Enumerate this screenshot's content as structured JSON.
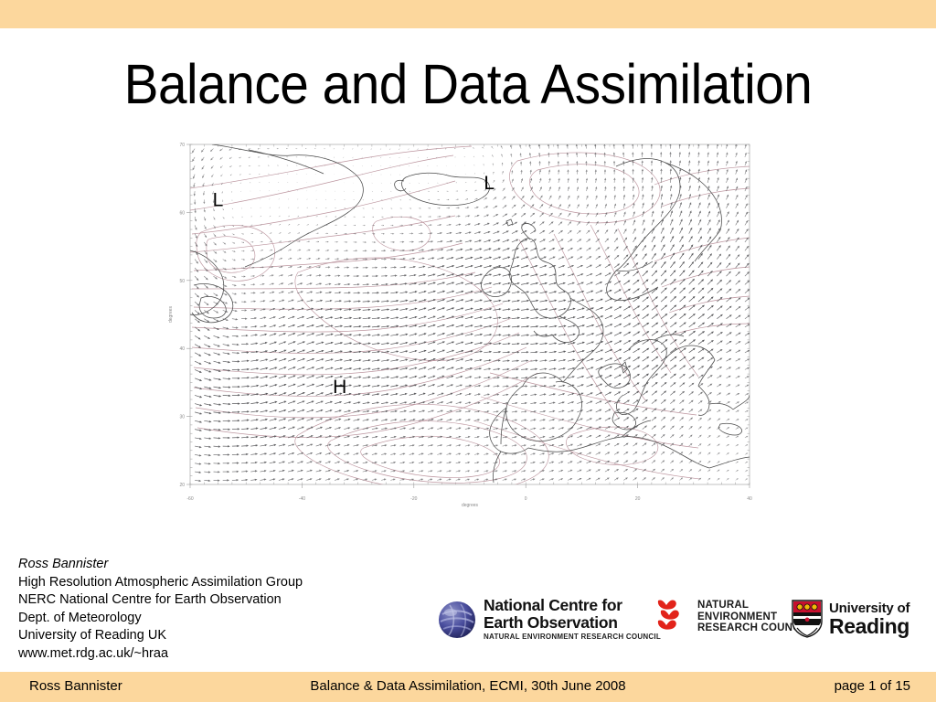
{
  "slide": {
    "title": "Balance and Data Assimilation",
    "banner_color": "#fcd79d"
  },
  "author": {
    "name": "Ross Bannister",
    "line2": "High Resolution Atmospheric Assimilation Group",
    "line3": "NERC National Centre for Earth Observation",
    "line4": "Dept. of Meteorology",
    "line5": "University of Reading UK",
    "line6": "www.met.rdg.ac.uk/~hraa"
  },
  "logos": {
    "nceo": {
      "line1": "National Centre for",
      "line2": "Earth Observation",
      "subtitle": "NATURAL ENVIRONMENT RESEARCH COUNCIL",
      "globe_color": "#3b3f8f"
    },
    "nerc": {
      "line1": "NATURAL",
      "line2": "ENVIRONMENT",
      "line3": "RESEARCH COUNCIL",
      "mark_color": "#e2231a"
    },
    "reading": {
      "line1": "University of",
      "line2": "Reading",
      "crest_red": "#c8102e",
      "crest_gold": "#f2b807"
    }
  },
  "footer": {
    "left": "Ross Bannister",
    "center": "Balance & Data Assimilation, ECMI, 30th June 2008",
    "right": "page 1 of 15"
  },
  "chart_data": {
    "type": "scatter",
    "title": "",
    "xlabel": "degrees",
    "ylabel": "degrees",
    "xlim": [
      -60,
      40
    ],
    "ylim": [
      20,
      70
    ],
    "xticks": [
      -60,
      -40,
      -20,
      0,
      20,
      40
    ],
    "xtick_labels": [
      "-60",
      "-40",
      "-20",
      "0",
      "20",
      "40"
    ],
    "yticks": [
      20,
      30,
      40,
      50,
      60,
      70
    ],
    "ytick_labels": [
      "20",
      "30",
      "40",
      "50",
      "60",
      "70"
    ],
    "grid": false,
    "legend": "none",
    "description": "North Atlantic / European synoptic chart: wind vector field (arrows) with geopotential height contours and coastlines",
    "annotations": [
      {
        "text": "L",
        "x": -55.0,
        "y": 62.0
      },
      {
        "text": "L",
        "x": -6.5,
        "y": 64.5
      },
      {
        "text": "H",
        "x": -33.5,
        "y": 34.5
      }
    ],
    "vector_field": {
      "name": "wind vectors",
      "color": "#555558",
      "grid_nx": 60,
      "grid_ny": 40,
      "comment": "arrow length proportional to wind speed; strongest (jet) band runs WSW-ENE across mid-Atlantic toward Biscay"
    },
    "contours": {
      "name": "height contours",
      "color": "#b48a94",
      "comment": "closed lows over NW Atlantic and Norwegian Sea, broad high over subtropical Atlantic"
    },
    "coastlines": {
      "color": "#4a4a4a"
    }
  }
}
